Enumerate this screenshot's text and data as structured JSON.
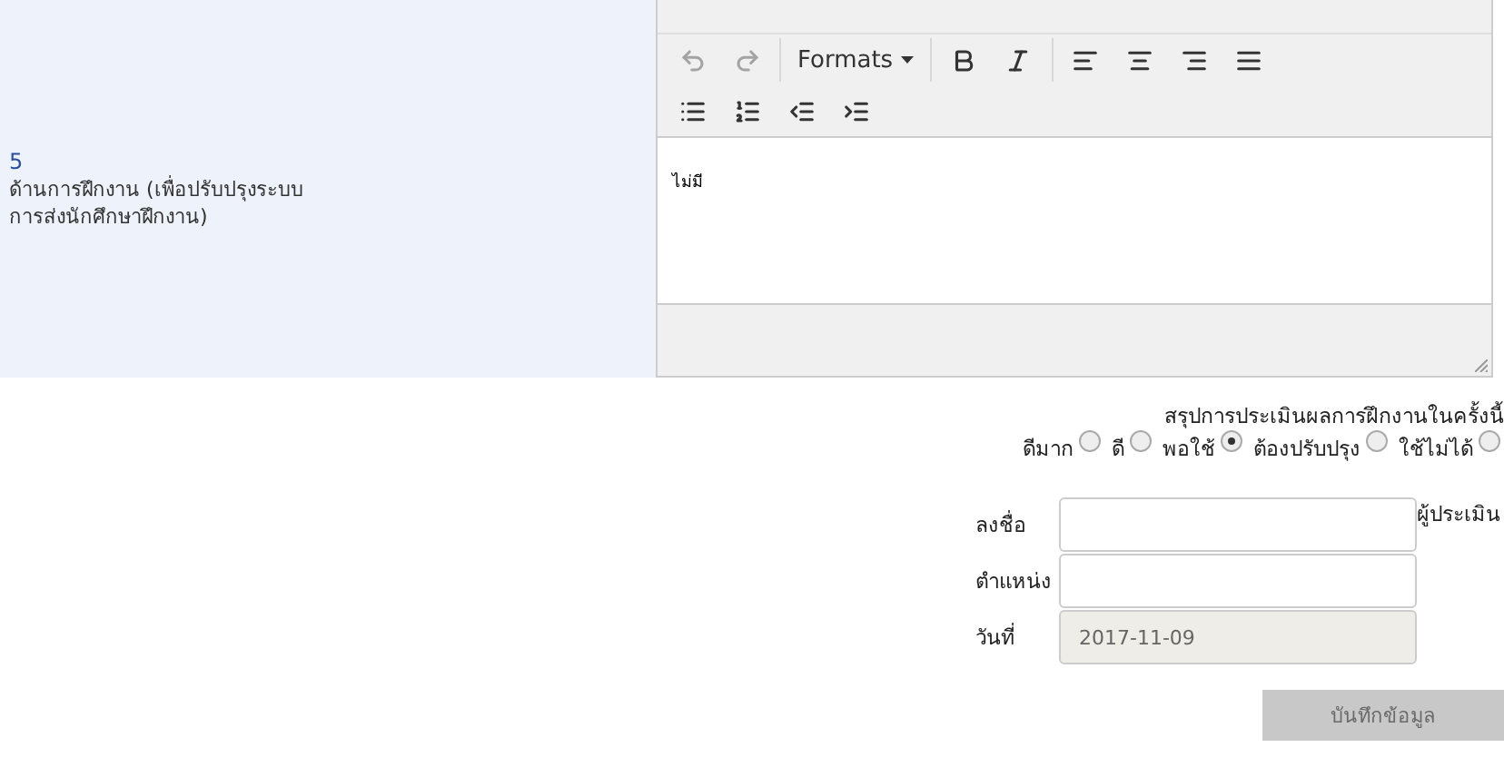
{
  "criterion": {
    "number": "5",
    "title_lines": [
      "ด้านการฝึกงาน (เพื่อปรับปรุงระบบ",
      "การส่งนักศึกษาฝึกงาน)"
    ]
  },
  "editor": {
    "toolbar_rows": [
      [
        {
          "kind": "undo",
          "disabled": true
        },
        {
          "kind": "redo",
          "disabled": true
        },
        {
          "kind": "separator"
        },
        {
          "kind": "formats",
          "label": "Formats",
          "disabled": false
        },
        {
          "kind": "separator"
        },
        {
          "kind": "bold",
          "disabled": false
        },
        {
          "kind": "italic",
          "disabled": false
        },
        {
          "kind": "separator"
        },
        {
          "kind": "align-left",
          "disabled": false
        },
        {
          "kind": "align-center",
          "disabled": false
        },
        {
          "kind": "align-right",
          "disabled": false
        },
        {
          "kind": "align-justify",
          "disabled": false
        }
      ],
      [
        {
          "kind": "bullet-list",
          "disabled": false
        },
        {
          "kind": "numbered-list",
          "disabled": false
        },
        {
          "kind": "outdent",
          "disabled": false
        },
        {
          "kind": "indent",
          "disabled": false
        }
      ]
    ],
    "content": "ไม่มี"
  },
  "summary": {
    "title": "สรุปการประเมินผลการฝึกงานในครั้งนี้",
    "options": [
      {
        "label": "ดีมาก",
        "selected": false
      },
      {
        "label": "ดี",
        "selected": false
      },
      {
        "label": "พอใช้",
        "selected": true
      },
      {
        "label": "ต้องปรับปรุง",
        "selected": false
      },
      {
        "label": "ใช้ไม่ได้",
        "selected": false
      }
    ]
  },
  "fields": [
    {
      "label": "ลงชื่อ",
      "disabled": false,
      "suffix": "ผู้ประเมิน"
    },
    {
      "label": "ตำแหน่ง",
      "disabled": false
    },
    {
      "label": "วันที่",
      "value": "2017-11-09",
      "disabled": true
    }
  ],
  "save_button": {
    "label": "บันทึกข้อมูล",
    "disabled": true
  }
}
